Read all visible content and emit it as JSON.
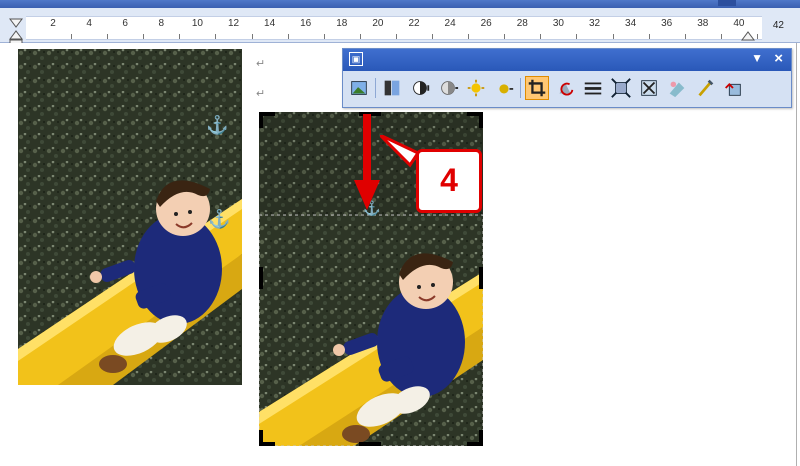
{
  "ruler": {
    "tick_labels": [
      "2",
      "4",
      "6",
      "8",
      "10",
      "12",
      "14",
      "16",
      "18",
      "20",
      "22",
      "24",
      "26",
      "28",
      "30",
      "32",
      "34",
      "36",
      "38",
      "40"
    ],
    "end_label": "42"
  },
  "document": {
    "paragraph_mark": "↵",
    "anchor_symbol": "⚓"
  },
  "picture_toolbar": {
    "title_icon": "picture-toolbar-icon",
    "buttons": [
      {
        "name": "insert-picture-icon",
        "active": false
      },
      {
        "name": "color-icon",
        "active": false
      },
      {
        "name": "more-contrast-icon",
        "active": false
      },
      {
        "name": "less-contrast-icon",
        "active": false
      },
      {
        "name": "more-brightness-icon",
        "active": false
      },
      {
        "name": "less-brightness-icon",
        "active": false
      },
      {
        "name": "crop-icon",
        "active": true
      },
      {
        "name": "rotate-left-icon",
        "active": false
      },
      {
        "name": "line-style-icon",
        "active": false
      },
      {
        "name": "compress-pictures-icon",
        "active": false
      },
      {
        "name": "text-wrapping-icon",
        "active": false
      },
      {
        "name": "format-picture-icon",
        "active": false
      },
      {
        "name": "set-transparent-color-icon",
        "active": false
      },
      {
        "name": "reset-picture-icon",
        "active": false
      }
    ]
  },
  "annotation": {
    "step_number": "4",
    "color": "#e00000"
  },
  "colors": {
    "slide": "#f2c21a",
    "jacket": "#1d2a7a",
    "foliage": "#2f3a2a"
  }
}
